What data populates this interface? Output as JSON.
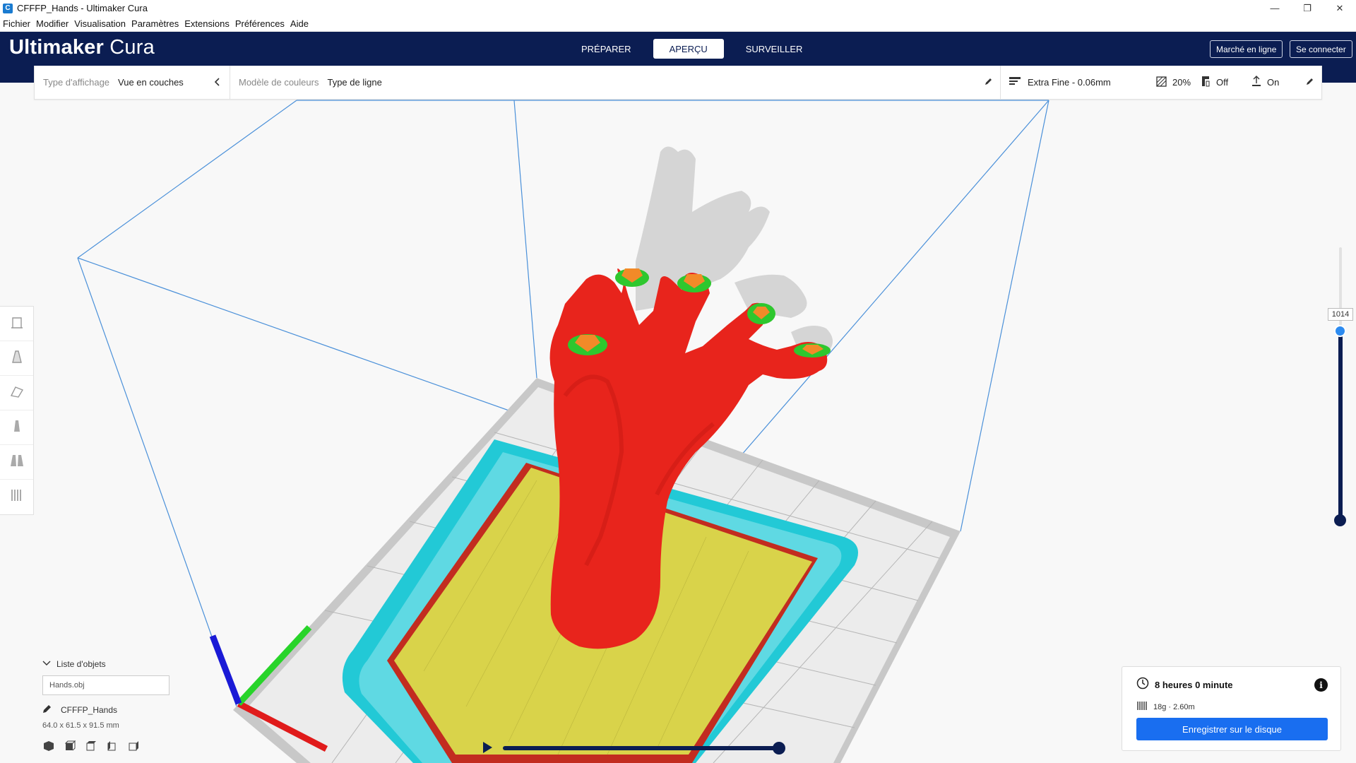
{
  "window": {
    "title": "CFFFP_Hands - Ultimaker Cura",
    "app_icon": "C",
    "minimize": "—",
    "maximize": "❐",
    "close": "✕"
  },
  "menu": [
    "Fichier",
    "Modifier",
    "Visualisation",
    "Paramètres",
    "Extensions",
    "Préférences",
    "Aide"
  ],
  "header": {
    "logo_bold": "Ultimaker",
    "logo_light": "Cura",
    "tabs": [
      {
        "label": "PRÉPARER",
        "active": false
      },
      {
        "label": "APERÇU",
        "active": true
      },
      {
        "label": "SURVEILLER",
        "active": false
      }
    ],
    "marketplace_label": "Marché en ligne",
    "signin_label": "Se connecter"
  },
  "settings_bar": {
    "view_type_label": "Type d'affichage",
    "view_type_value": "Vue en couches",
    "color_scheme_label": "Modèle de couleurs",
    "color_scheme_value": "Type de ligne",
    "profile": "Extra Fine - 0.06mm",
    "infill": "20%",
    "support": "Off",
    "adhesion": "On"
  },
  "layer_slider": {
    "current_layer": "1014"
  },
  "object_list": {
    "title": "Liste d'objets",
    "file": "Hands.obj",
    "object_name": "CFFFP_Hands",
    "dimensions": "64.0 x 61.5 x 91.5 mm"
  },
  "print_info": {
    "time": "8 heures 0 minute",
    "material": "18g · 2.60m",
    "save_label": "Enregistrer sur le disque"
  },
  "colors": {
    "header_bg": "#0b1d52",
    "accent": "#196ef0",
    "model_wall": "#e8241c",
    "infill": "#d9d34a",
    "skirt": "#22c9d6",
    "axis_x": "#e01b1b",
    "axis_y": "#28d42a",
    "axis_z": "#1a1ad6"
  }
}
